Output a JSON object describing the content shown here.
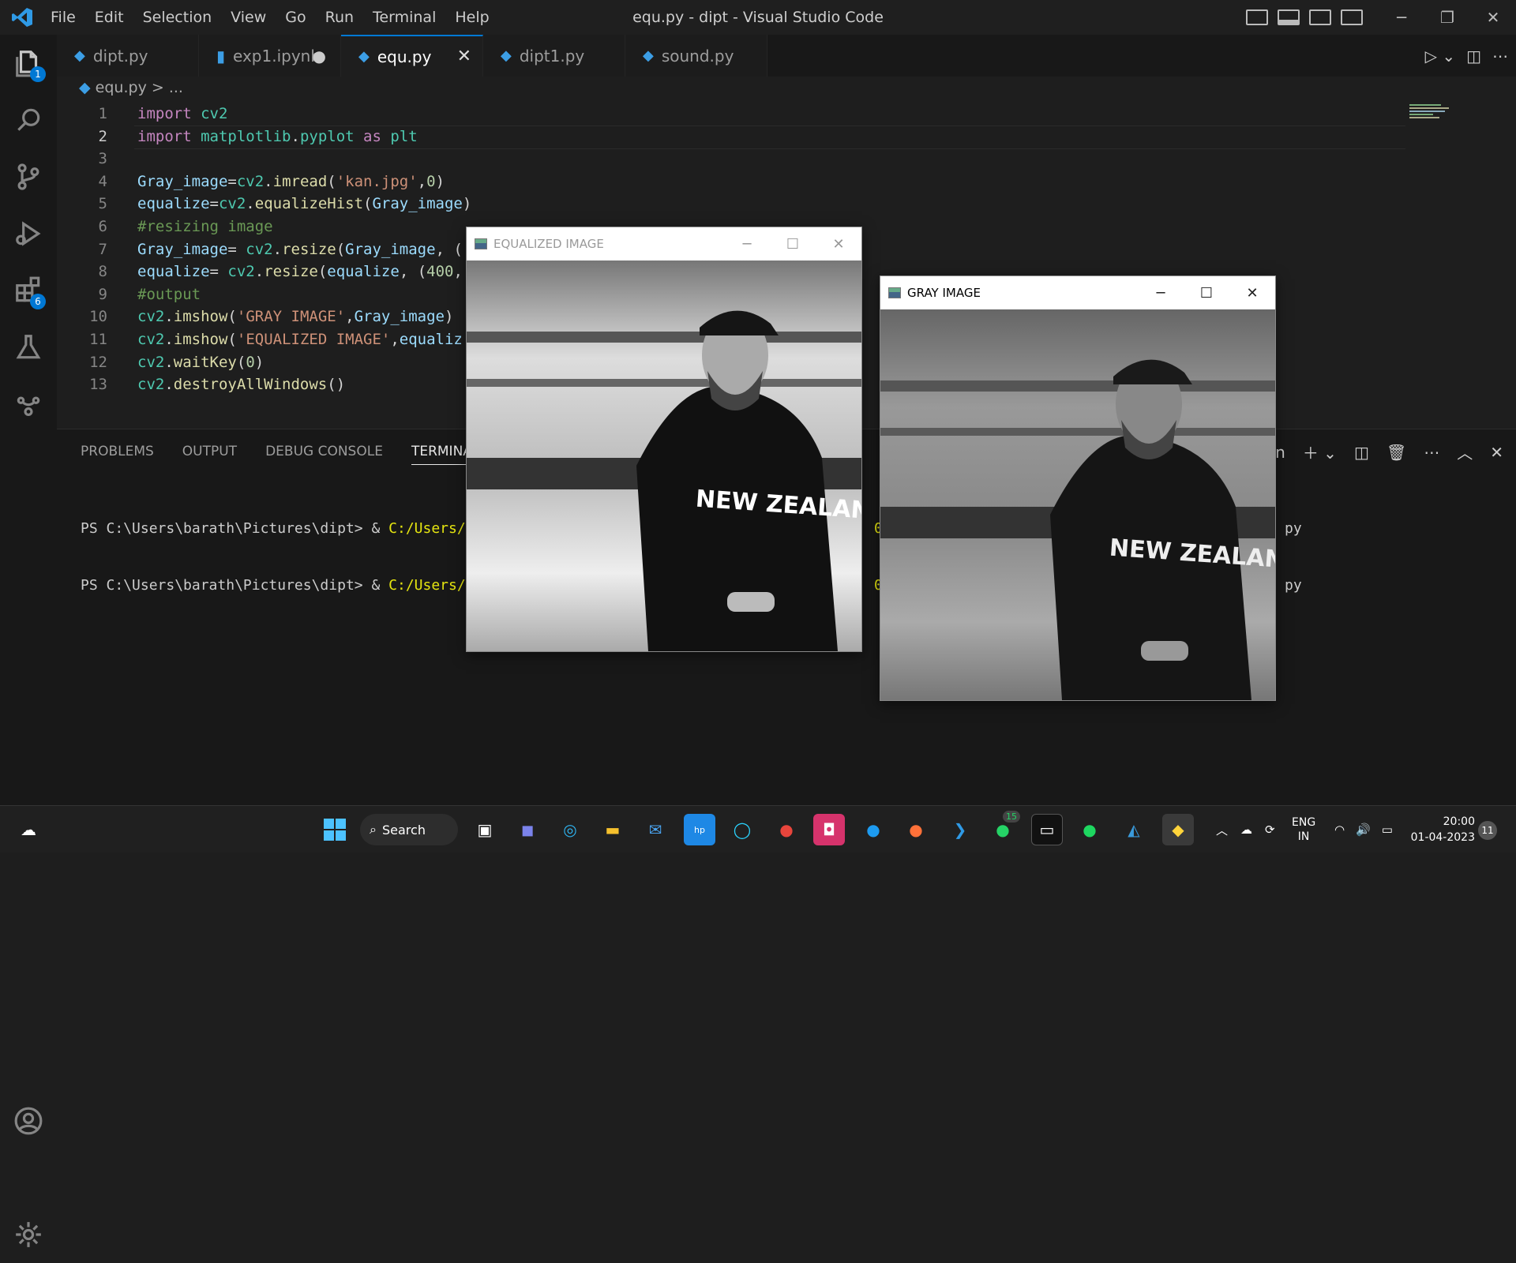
{
  "window": {
    "title": "equ.py - dipt - Visual Studio Code"
  },
  "menu": [
    "File",
    "Edit",
    "Selection",
    "View",
    "Go",
    "Run",
    "Terminal",
    "Help"
  ],
  "activity": {
    "explorer_badge": "1",
    "extensions_badge": "6"
  },
  "tabs": [
    {
      "label": "dipt.py",
      "icon": "python-icon"
    },
    {
      "label": "exp1.ipynb",
      "icon": "notebook-icon",
      "modified": "●"
    },
    {
      "label": "equ.py",
      "icon": "python-icon",
      "close": "✕"
    },
    {
      "label": "dipt1.py",
      "icon": "python-icon"
    },
    {
      "label": "sound.py",
      "icon": "python-icon"
    }
  ],
  "breadcrumb": {
    "file": "equ.py",
    "sep": ">",
    "rest": "..."
  },
  "code": [
    {
      "n": "1",
      "t": "import cv2"
    },
    {
      "n": "2",
      "t": "import matplotlib.pyplot as plt"
    },
    {
      "n": "3",
      "t": ""
    },
    {
      "n": "4",
      "t": "Gray_image=cv2.imread('kan.jpg',0)"
    },
    {
      "n": "5",
      "t": "equalize=cv2.equalizeHist(Gray_image)"
    },
    {
      "n": "6",
      "t": "#resizing image"
    },
    {
      "n": "7",
      "t": "Gray_image= cv2.resize(Gray_image, ("
    },
    {
      "n": "8",
      "t": "equalize= cv2.resize(equalize, (400,"
    },
    {
      "n": "9",
      "t": "#output"
    },
    {
      "n": "10",
      "t": "cv2.imshow('GRAY IMAGE',Gray_image)"
    },
    {
      "n": "11",
      "t": "cv2.imshow('EQUALIZED IMAGE',equaliz"
    },
    {
      "n": "12",
      "t": "cv2.waitKey(0)"
    },
    {
      "n": "13",
      "t": "cv2.destroyAllWindows()"
    }
  ],
  "panel": {
    "tabs": [
      "PROBLEMS",
      "OUTPUT",
      "DEBUG CONSOLE",
      "TERMINAL"
    ],
    "active": "TERMINAL",
    "shell_fragment": "hon",
    "lines": [
      {
        "prompt": "PS C:\\Users\\barath\\Pictures\\dipt> & ",
        "path": "C:/Users/",
        "mid": "0/",
        "end": "py"
      },
      {
        "prompt": "PS C:\\Users\\barath\\Pictures\\dipt> & ",
        "path": "C:/Users/",
        "mid": "0/",
        "end": "py"
      }
    ]
  },
  "cv_windows": {
    "equalized": {
      "title": "EQUALIZED IMAGE"
    },
    "gray": {
      "title": "GRAY IMAGE"
    },
    "jersey_text": "NEW ZEALAN"
  },
  "taskbar": {
    "search": "Search",
    "whatsapp_badge": "15",
    "lang": "ENG",
    "region": "IN",
    "time": "20:00",
    "date": "01-04-2023",
    "notif": "11"
  }
}
